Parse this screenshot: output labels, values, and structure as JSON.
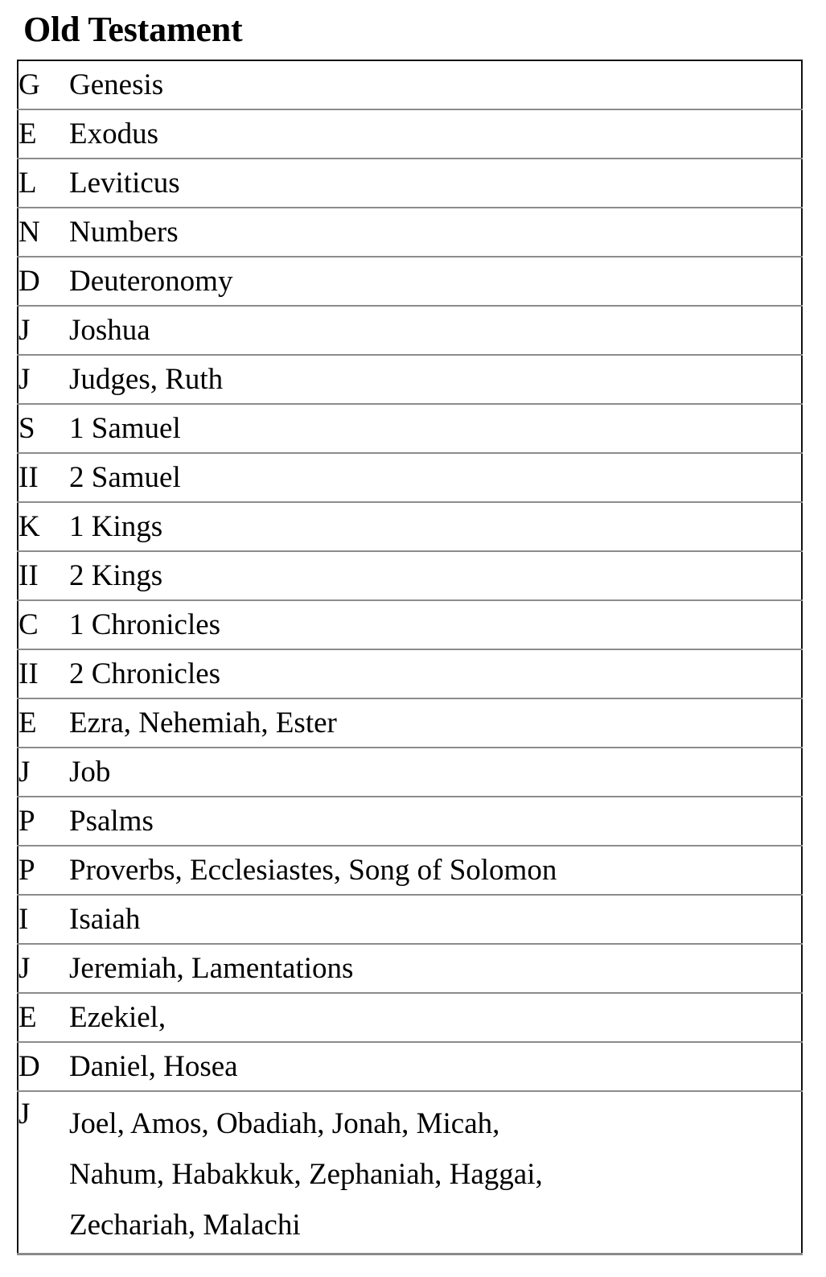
{
  "document": {
    "title": "Old Testament"
  },
  "table": {
    "name": "old-testament-books-table",
    "columns": [
      "initial",
      "books"
    ],
    "rows": [
      {
        "initial": "G",
        "books": "Genesis"
      },
      {
        "initial": "E",
        "books": "Exodus"
      },
      {
        "initial": "L",
        "books": "Leviticus"
      },
      {
        "initial": "N",
        "books": "Numbers"
      },
      {
        "initial": "D",
        "books": "Deuteronomy"
      },
      {
        "initial": "J",
        "books": "Joshua"
      },
      {
        "initial": "J",
        "books": "Judges, Ruth"
      },
      {
        "initial": "S",
        "books": "1 Samuel"
      },
      {
        "initial": "II",
        "books": "2 Samuel"
      },
      {
        "initial": "K",
        "books": "1 Kings"
      },
      {
        "initial": "II",
        "books": "2 Kings"
      },
      {
        "initial": "C",
        "books": "1 Chronicles"
      },
      {
        "initial": "II",
        "books": "2 Chronicles"
      },
      {
        "initial": "E",
        "books": "Ezra, Nehemiah, Ester"
      },
      {
        "initial": "J",
        "books": "Job"
      },
      {
        "initial": "P",
        "books": "Psalms"
      },
      {
        "initial": "P",
        "books": "Proverbs, Ecclesiastes, Song of Solomon"
      },
      {
        "initial": "I",
        "books": "Isaiah"
      },
      {
        "initial": "J",
        "books": "Jeremiah, Lamentations"
      },
      {
        "initial": "E",
        "books": "Ezekiel,"
      },
      {
        "initial": "D",
        "books": "Daniel, Hosea"
      },
      {
        "initial": "J",
        "books": "Joel, Amos, Obadiah, Jonah, Micah, Nahum, Habakkuk, Zephaniah, Haggai, Zechariah, Malachi",
        "multiline": true,
        "lines": [
          "Joel, Amos, Obadiah, Jonah, Micah,",
          "Nahum, Habakkuk, Zephaniah, Haggai,",
          "Zechariah, Malachi"
        ]
      }
    ]
  },
  "colors": {
    "text": "#000000",
    "background": "#ffffff",
    "border_outer": "#111111",
    "border_inner": "#8c8c8c"
  }
}
